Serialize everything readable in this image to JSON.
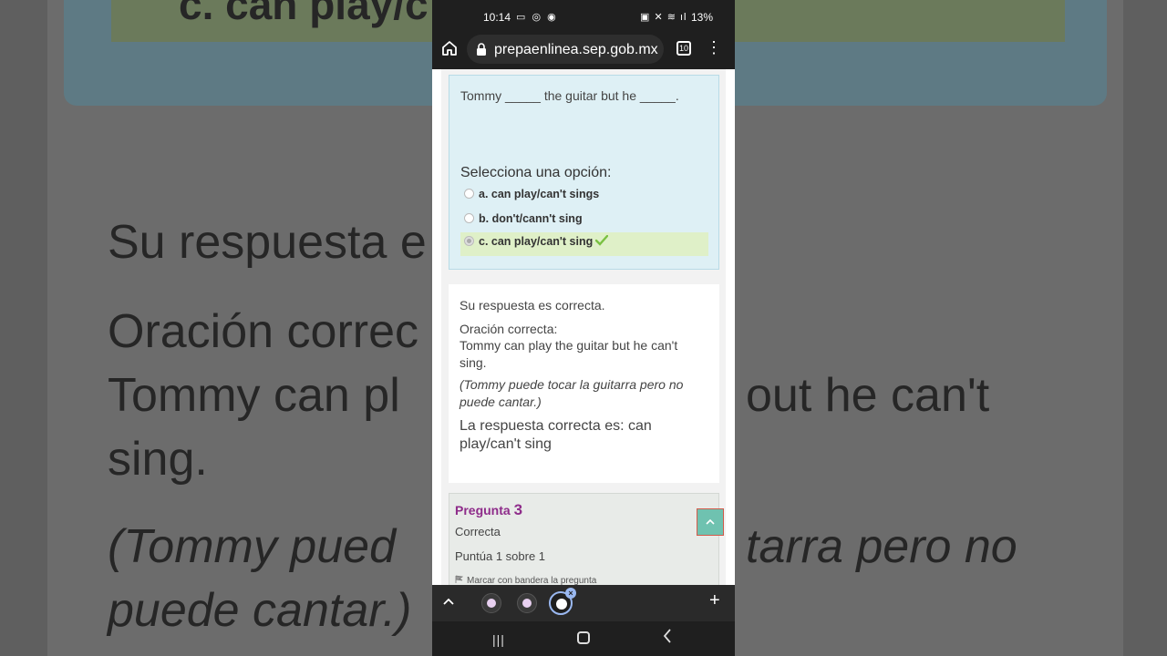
{
  "background": {
    "card_option": "c. can play/c",
    "line1": "Su respuesta e",
    "line2": "Oración correc",
    "line3": "Tommy can pl",
    "line3_right": "out he can't",
    "line4": "sing.",
    "line5": "(Tommy pued",
    "line5_right": "tarra pero no",
    "line6": "puede cantar.)"
  },
  "status_bar": {
    "time": "10:14",
    "left_icons": "▭ ◎ ◉",
    "right_icons": "▣ ✕ ≋ ıl",
    "battery": "13%"
  },
  "browser": {
    "url": "prepaenlinea.sep.gob.mx",
    "tab_count": "10"
  },
  "question": {
    "text": "Tommy _____ the guitar but he _____.",
    "prompt": "Selecciona una opción:",
    "options": [
      {
        "label": "a. can play/can't sings",
        "selected": false
      },
      {
        "label": "b. don't/cann't sing",
        "selected": false
      },
      {
        "label": "c. can play/can't sing",
        "selected": true,
        "correct": true
      }
    ]
  },
  "feedback": {
    "result": "Su respuesta es correcta.",
    "correct_sentence_label": "Oración correcta:",
    "correct_sentence": "Tommy can play the guitar but he can't sing.",
    "translation": "(Tommy puede tocar la guitarra pero no puede cantar.)",
    "correct_answer": "La respuesta correcta es: can play/can't sing"
  },
  "next_question": {
    "label": "Pregunta",
    "number": "3",
    "status": "Correcta",
    "score": "Puntúa 1 sobre 1",
    "flag_label": "Marcar con bandera la pregunta"
  },
  "tabstrip": {
    "close_glyph": "×",
    "new_tab_glyph": "+"
  },
  "colors": {
    "question_bg": "#def0f5",
    "selected_option_bg": "#dff0c8",
    "pregunta_purple": "#8e2c8a",
    "scroll_button": "#6fc2b0",
    "check_green": "#7ac142"
  }
}
